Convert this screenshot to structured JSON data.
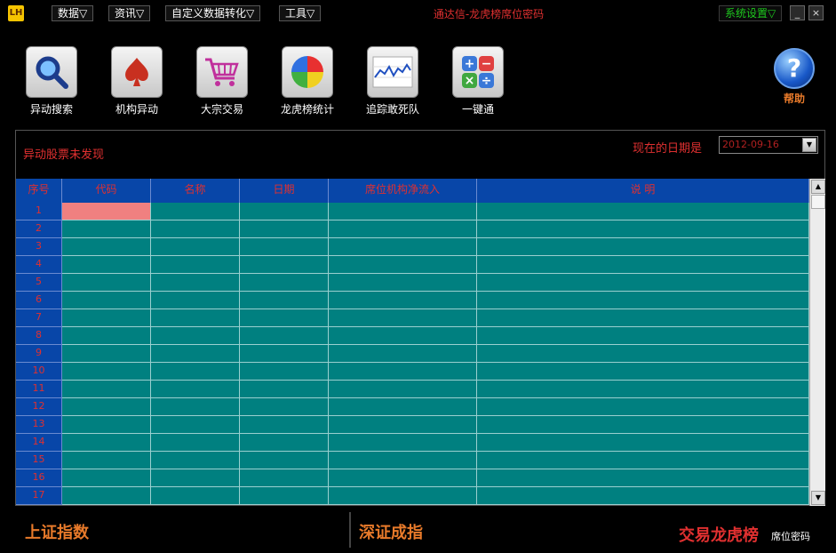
{
  "titlebar": {
    "logo": "LH",
    "menus": [
      "数据▽",
      "资讯▽",
      "自定义数据转化▽",
      "工具▽"
    ],
    "title": "通达信-龙虎榜席位密码",
    "system_settings": "系统设置▽",
    "minimize": "_",
    "close": "×"
  },
  "toolbar": {
    "items": [
      {
        "label": "异动搜索",
        "icon": "magnifier-icon"
      },
      {
        "label": "机构异动",
        "icon": "spade-icon"
      },
      {
        "label": "大宗交易",
        "icon": "shopping-cart-icon"
      },
      {
        "label": "龙虎榜统计",
        "icon": "pie-chart-icon"
      },
      {
        "label": "追踪敢死队",
        "icon": "line-chart-icon"
      },
      {
        "label": "一键通",
        "icon": "calculator-icon"
      }
    ],
    "help_label": "帮助",
    "help_glyph": "?"
  },
  "panel": {
    "status": "异动股票未发现",
    "date_label": "现在的日期是",
    "date_value": "2012-09-16"
  },
  "table": {
    "columns": [
      "序号",
      "代码",
      "名称",
      "日期",
      "席位机构净流入",
      "说 明"
    ],
    "row_numbers": [
      "1",
      "2",
      "3",
      "4",
      "5",
      "6",
      "7",
      "8",
      "9",
      "10",
      "11",
      "12",
      "13",
      "14",
      "15",
      "16",
      "17"
    ]
  },
  "footer": {
    "sh_index": "上证指数",
    "sz_index": "深证成指",
    "brand": "交易龙虎榜",
    "brand_sub": "席位密码"
  },
  "colors": {
    "header_blue": "#0846a8",
    "cell_teal": "#008080",
    "selected_cell": "#f08080",
    "accent_red": "#e03030",
    "accent_orange": "#e87a2a"
  }
}
